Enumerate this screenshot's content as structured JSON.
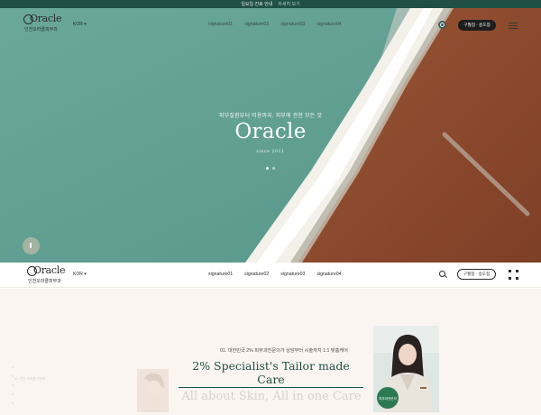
{
  "topbar": {
    "notice": "일요일 진료 안내",
    "more": "자세히 보기"
  },
  "brand": {
    "logo_text": "Oracle",
    "logo_sub": "인천오라클피부과",
    "hero_name": "Oracle",
    "since": "since 2011"
  },
  "nav": {
    "lang": "KOR ▾",
    "items": [
      "signature01",
      "signature02",
      "signature03",
      "signature04"
    ],
    "branch_button": "구월점 · 송도점"
  },
  "hero": {
    "tagline": "피부질환부터 미용까지, 피부에 관한 모든 것",
    "slides_total": 2,
    "active_slide": 1
  },
  "section": {
    "side_label": "01. 인천 오라클 전문의",
    "kicker": "01. 대한민국 2% 피부과전문의가 상담부터 시술까지 1:1 맞춤케어",
    "headline": "2% Specialist's Tailor made Care",
    "subhead": "All about Skin, All in one Care",
    "badge": "피부과전문의"
  },
  "colors": {
    "accent": "#1f4f45",
    "sea": "#5f9e92",
    "sand": "#8d4a30",
    "section_bg": "#fbf5f1"
  }
}
